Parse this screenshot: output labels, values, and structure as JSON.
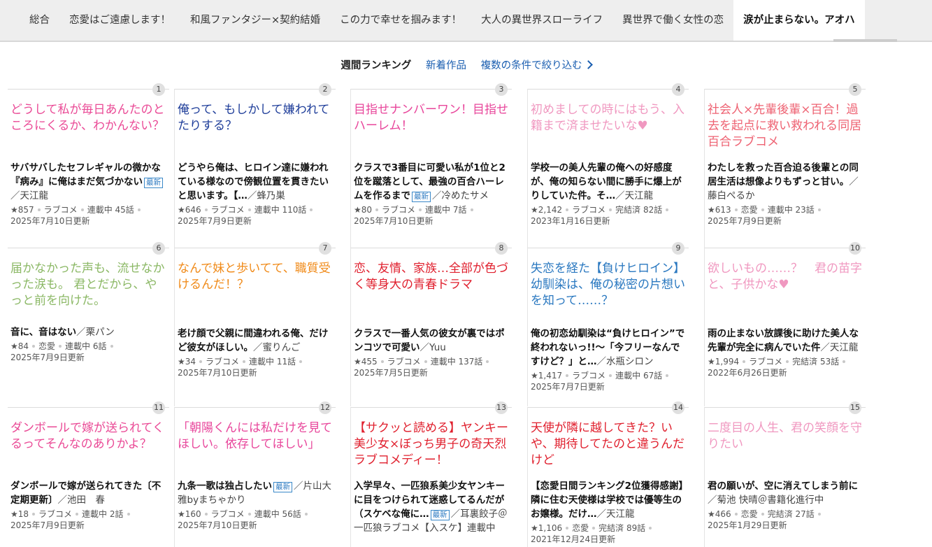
{
  "tabs": [
    {
      "label": "総合"
    },
    {
      "label": "恋愛はご遠慮します！"
    },
    {
      "label": "和風ファンタジー×契約結婚"
    },
    {
      "label": "この力で幸せを掴みます！"
    },
    {
      "label": "大人の異世界スローライフ"
    },
    {
      "label": "異世界で働く女性の恋"
    },
    {
      "label": "涙が止まらない。アオハ"
    }
  ],
  "subnav": {
    "current": "週間ランキング",
    "new_works": "新着作品",
    "filter": "複数の条件で絞り込む"
  },
  "badge_label": "最新",
  "colors": {
    "pink": "#e8469b",
    "navy": "#1f3e9a",
    "orange": "#f08a18",
    "red": "#e0202e",
    "blue": "#2a78c0",
    "green": "#8bb865",
    "lightpink": "#f098c0",
    "coral": "#ee6272",
    "hotpink": "#ea4a96"
  },
  "works": [
    {
      "rank": "1",
      "catch": "どうして私が毎日あんたのところにくるか、わかんない？",
      "catch_color": "hotpink",
      "title": "サバサバしたセフレギャルの微かな『病み』に俺はまだ気づかない",
      "badge": true,
      "author": "／天江龍",
      "stars": "★857",
      "genre": "ラブコメ",
      "status": "連載中 45話",
      "date": "2025年7月10日更新"
    },
    {
      "rank": "2",
      "catch": "俺って、もしかして嫌われてたりする？",
      "catch_color": "navy",
      "title": "どうやら俺は、ヒロイン達に嫌われている様なので傍観位置を貫きたいと思います。【…",
      "badge": false,
      "author": "／蜂乃巣",
      "stars": "★646",
      "genre": "ラブコメ",
      "status": "連載中 110話",
      "date": "2025年7月9日更新"
    },
    {
      "rank": "3",
      "catch": "目指せナンバーワン！目指せハーレム！",
      "catch_color": "pink",
      "title": "クラスで3番目に可愛い私が1位と2位を蹴落として、最強の百合ハーレムを作るまで",
      "badge": true,
      "author": "／冷めたサメ",
      "stars": "★80",
      "genre": "ラブコメ",
      "status": "連載中 7話",
      "date": "2025年7月10日更新"
    },
    {
      "rank": "4",
      "catch": "初めましての時にはもう、入籍まで済ませたいな♥",
      "catch_color": "lightpink",
      "title": "学校一の美人先輩の俺への好感度が、俺の知らない間に勝手に爆上がりしていた件。そ…",
      "badge": false,
      "author": "／天江龍",
      "stars": "★2,142",
      "genre": "ラブコメ",
      "status": "完結済 82話",
      "date": "2023年1月16日更新"
    },
    {
      "rank": "5",
      "catch": "社会人×先輩後輩×百合！過去を起点に救い救われる同居百合ラブコメ",
      "catch_color": "coral",
      "title": "わたしを救った百合迫る後輩との同居生活は想像よりもずっと甘い。",
      "badge": false,
      "author": "／藤白ぺるか",
      "stars": "★613",
      "genre": "恋愛",
      "status": "連載中 23話",
      "date": "2025年7月9日更新"
    },
    {
      "rank": "6",
      "catch": "届かなかった声も、流せなかった涙も。 君とだから、やっと前を向けた。",
      "catch_color": "green",
      "title": "音に、音はない",
      "badge": false,
      "author": "／栗パン",
      "stars": "★84",
      "genre": "恋愛",
      "status": "連載中 6話",
      "date": "2025年7月9日更新"
    },
    {
      "rank": "7",
      "catch": "なんで妹と歩いてて、職質受けるんだ！？",
      "catch_color": "orange",
      "title": "老け顔で父親に間違われる俺、だけど彼女がほしい。",
      "badge": false,
      "author": "／蜜りんご",
      "stars": "★34",
      "genre": "ラブコメ",
      "status": "連載中 11話",
      "date": "2025年7月10日更新"
    },
    {
      "rank": "8",
      "catch": "恋、友情、家族…全部が色づく等身大の青春ドラマ",
      "catch_color": "red",
      "title": "クラスで一番人気の彼女が裏ではポンコツで可愛い",
      "badge": false,
      "author": "／Yuu",
      "stars": "★455",
      "genre": "ラブコメ",
      "status": "連載中 137話",
      "date": "2025年7月5日更新"
    },
    {
      "rank": "9",
      "catch": "失恋を経た【負けヒロイン】幼馴染は、俺の秘密の片想いを知って……？",
      "catch_color": "blue",
      "title": "俺の初恋幼馴染は“負けヒロイン”で終われないっ!!～「今フリーなんですけど？」と…",
      "badge": false,
      "author": "／水瓶シロン",
      "stars": "★1,417",
      "genre": "ラブコメ",
      "status": "連載中 67話",
      "date": "2025年7月7日更新"
    },
    {
      "rank": "10",
      "catch": "欲しいもの……？　君の苗字と、子供かな♥",
      "catch_color": "lightpink",
      "title": "雨の止まない放課後に助けた美人な先輩が完全に病んでいた件",
      "badge": false,
      "author": "／天江龍",
      "stars": "★1,994",
      "genre": "ラブコメ",
      "status": "完結済 53話",
      "date": "2022年6月26日更新"
    },
    {
      "rank": "11",
      "catch": "ダンボールで嫁が送られてくるってそんなのありかよ？",
      "catch_color": "hotpink",
      "title": "ダンボールで嫁が送られてきた〔不定期更新〕",
      "badge": false,
      "author": "／池田　春",
      "stars": "★18",
      "genre": "ラブコメ",
      "status": "連載中 2話",
      "date": "2025年7月9日更新"
    },
    {
      "rank": "12",
      "catch": "「朝陽くんには私だけを見てほしい。依存してほしい」",
      "catch_color": "pink",
      "title": "九条一歌は独占したい",
      "badge": true,
      "author": "／片山大雅byまちゃかり",
      "stars": "★160",
      "genre": "ラブコメ",
      "status": "連載中 56話",
      "date": "2025年7月10日更新"
    },
    {
      "rank": "13",
      "catch": "【サクッと読める】ヤンキー美少女×ぼっち男子の奇天烈ラブコメディー！",
      "catch_color": "red",
      "title": "入学早々、一匹狼系美少女ヤンキーに目をつけられて迷惑してるんだが（スケベな俺に…",
      "badge": true,
      "author": "／耳裏餃子＠一匹狼ラブコメ【入スケ】連載中",
      "stars": "",
      "genre": "",
      "status": "",
      "date": ""
    },
    {
      "rank": "14",
      "catch": "天使が隣に越してきた？いや、期待してたのと違うんだけど",
      "catch_color": "red",
      "title": "【恋愛日間ランキング2位獲得感謝】隣に住む天使様は学校では優等生のお嬢様。だけ…",
      "badge": false,
      "author": "／天江龍",
      "stars": "★1,106",
      "genre": "恋愛",
      "status": "完結済 89話",
      "date": "2021年12月24日更新"
    },
    {
      "rank": "15",
      "catch": "二度目の人生、君の笑顔を守りたい",
      "catch_color": "lightpink",
      "title": "君の願いが、空に消えてしまう前に",
      "badge": false,
      "author": "／菊池 快晴＠書籍化進行中",
      "stars": "★466",
      "genre": "恋愛",
      "status": "完結済 27話",
      "date": "2025年1月29日更新"
    }
  ]
}
